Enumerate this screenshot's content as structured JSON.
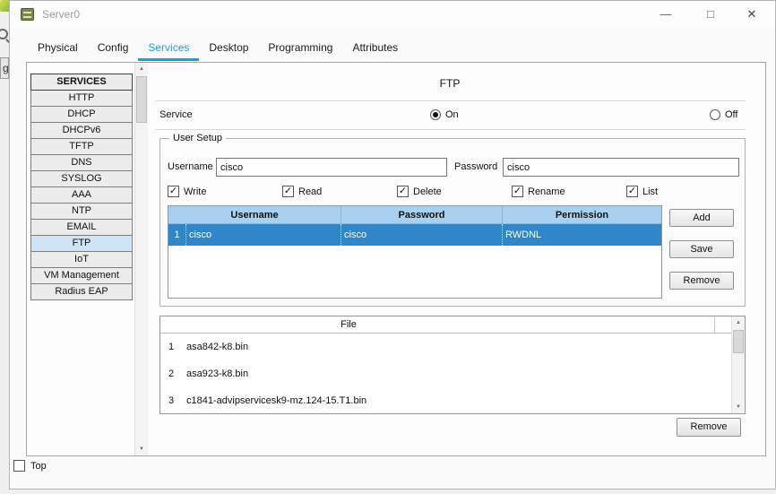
{
  "window": {
    "title": "Server0"
  },
  "icons": {
    "check": "✓",
    "minimize": "—",
    "maximize": "□",
    "close": "✕",
    "scroll_up": "▲",
    "scroll_down": "▼"
  },
  "background": {
    "partial_label": "g"
  },
  "tabs": [
    {
      "label": "Physical"
    },
    {
      "label": "Config"
    },
    {
      "label": "Services"
    },
    {
      "label": "Desktop"
    },
    {
      "label": "Programming"
    },
    {
      "label": "Attributes"
    }
  ],
  "sidebar": {
    "header": "SERVICES",
    "items": [
      {
        "label": "HTTP"
      },
      {
        "label": "DHCP"
      },
      {
        "label": "DHCPv6"
      },
      {
        "label": "TFTP"
      },
      {
        "label": "DNS"
      },
      {
        "label": "SYSLOG"
      },
      {
        "label": "AAA"
      },
      {
        "label": "NTP"
      },
      {
        "label": "EMAIL"
      },
      {
        "label": "FTP"
      },
      {
        "label": "IoT"
      },
      {
        "label": "VM Management"
      },
      {
        "label": "Radius EAP"
      }
    ],
    "selected": "FTP"
  },
  "ftp": {
    "title": "FTP",
    "service_label": "Service",
    "radio_on": "On",
    "radio_off": "Off",
    "service_state": "On",
    "user_setup": {
      "group_label": "User Setup",
      "username_label": "Username",
      "username_value": "cisco",
      "password_label": "Password",
      "password_value": "cisco",
      "permissions": [
        {
          "label": "Write",
          "checked": true
        },
        {
          "label": "Read",
          "checked": true
        },
        {
          "label": "Delete",
          "checked": true
        },
        {
          "label": "Rename",
          "checked": true
        },
        {
          "label": "List",
          "checked": true
        }
      ],
      "table": {
        "columns": [
          "Username",
          "Password",
          "Permission"
        ],
        "rows": [
          {
            "index": "1",
            "username": "cisco",
            "password": "cisco",
            "permission": "RWDNL",
            "selected": true
          }
        ]
      },
      "buttons": {
        "add": "Add",
        "save": "Save",
        "remove": "Remove"
      }
    },
    "file_table": {
      "column": "File",
      "rows": [
        {
          "index": "1",
          "file": "asa842-k8.bin"
        },
        {
          "index": "2",
          "file": "asa923-k8.bin"
        },
        {
          "index": "3",
          "file": "c1841-advipservicesk9-mz.124-15.T1.bin"
        }
      ],
      "remove_label": "Remove"
    }
  },
  "footer": {
    "top_label": "Top"
  },
  "colors": {
    "tab_active": "#15a3e0",
    "table_header": "#a9d0ee",
    "row_selected": "#3086c8",
    "sidebar_selected": "#cfe4f7"
  }
}
